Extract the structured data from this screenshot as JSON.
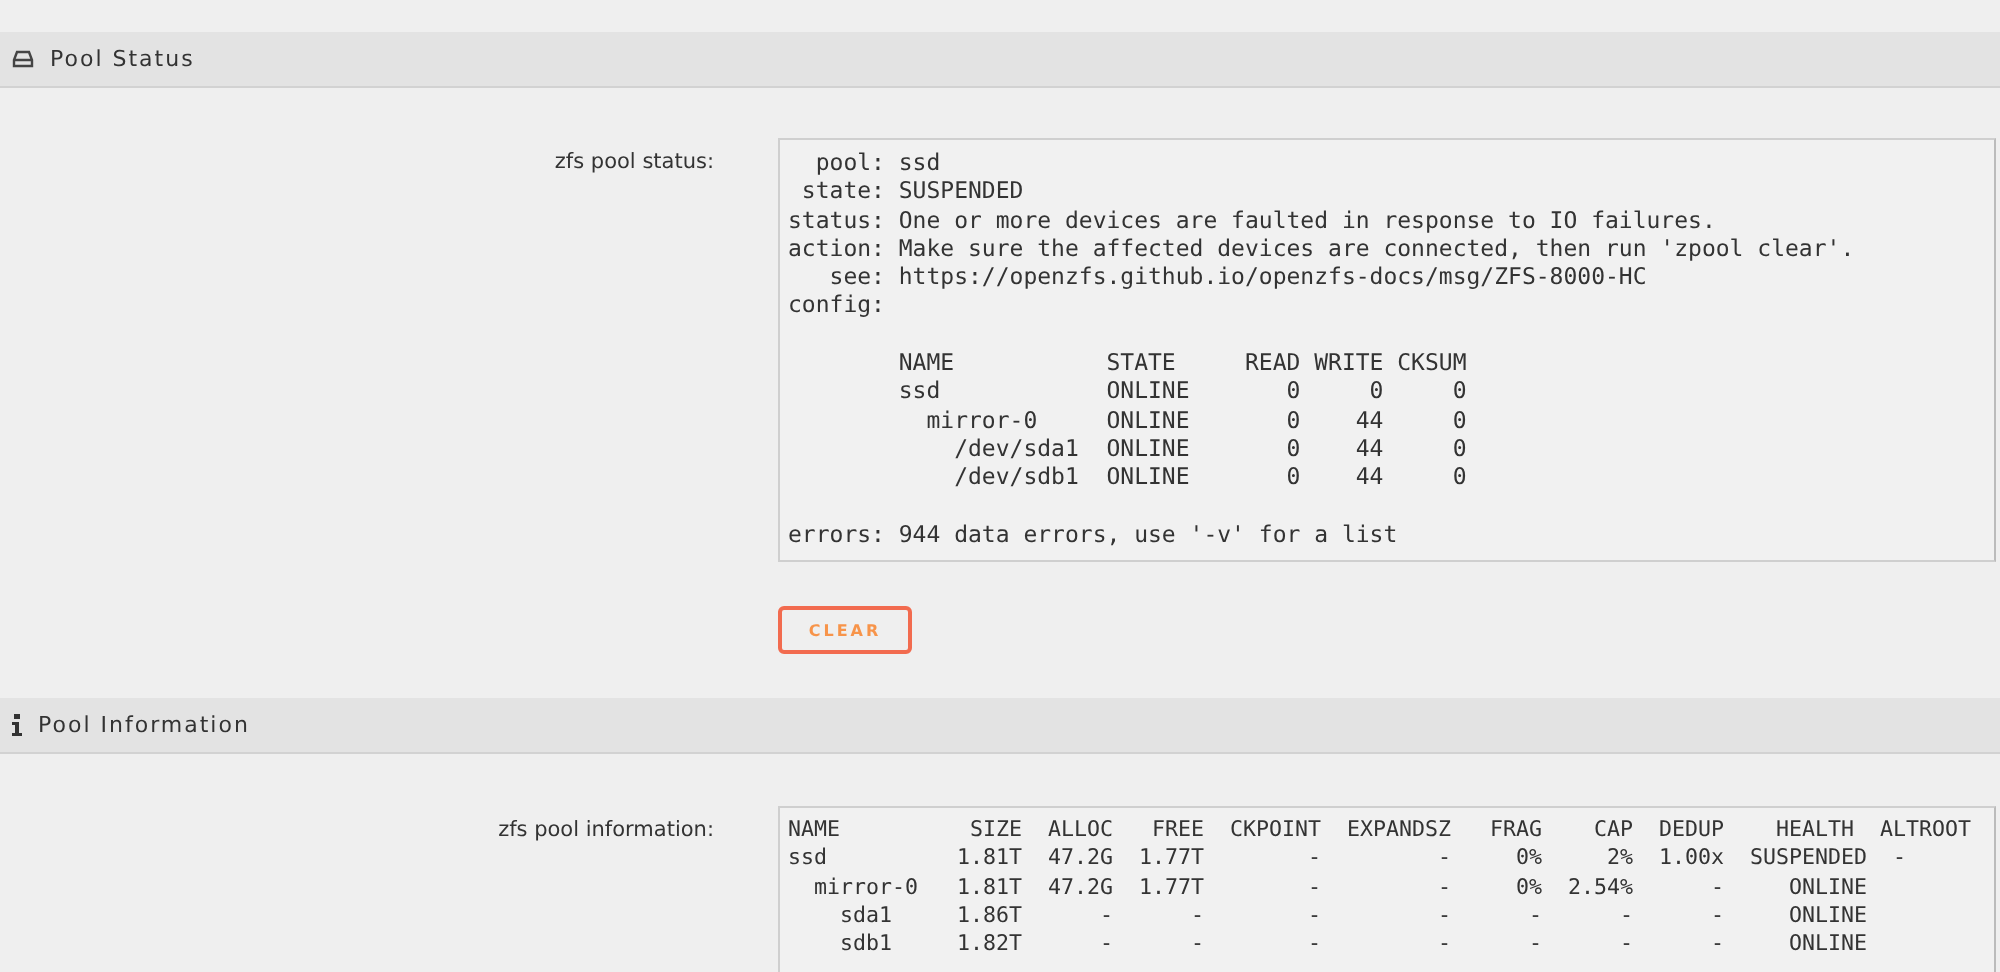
{
  "sections": [
    {
      "title": "Pool Status",
      "label": "zfs pool status:",
      "blocks": [
        [
          "  pool: ssd",
          " state: SUSPENDED",
          "status: One or more devices are faulted in response to IO failures.",
          "action: Make sure the affected devices are connected, then run 'zpool clear'.",
          "   see: https://openzfs.github.io/openzfs-docs/msg/ZFS-8000-HC",
          "config:"
        ],
        [
          "        NAME           STATE     READ WRITE CKSUM",
          "        ssd            ONLINE       0     0     0",
          "          mirror-0     ONLINE       0    44     0",
          "            /dev/sda1  ONLINE       0    44     0",
          "            /dev/sdb1  ONLINE       0    44     0"
        ],
        [
          "errors: 944 data errors, use '-v' for a list"
        ]
      ],
      "button": "CLEAR"
    },
    {
      "title": "Pool Information",
      "label": "zfs pool information:",
      "blocks": [
        [
          "NAME          SIZE  ALLOC   FREE  CKPOINT  EXPANDSZ   FRAG    CAP  DEDUP    HEALTH  ALTROOT",
          "ssd          1.81T  47.2G  1.77T        -         -     0%     2%  1.00x  SUSPENDED  -",
          "  mirror-0   1.81T  47.2G  1.77T        -         -     0%  2.54%      -     ONLINE",
          "    sda1     1.86T      -      -        -         -      -      -      -     ONLINE",
          "    sdb1     1.82T      -      -        -         -      -      -      -     ONLINE"
        ]
      ]
    }
  ]
}
